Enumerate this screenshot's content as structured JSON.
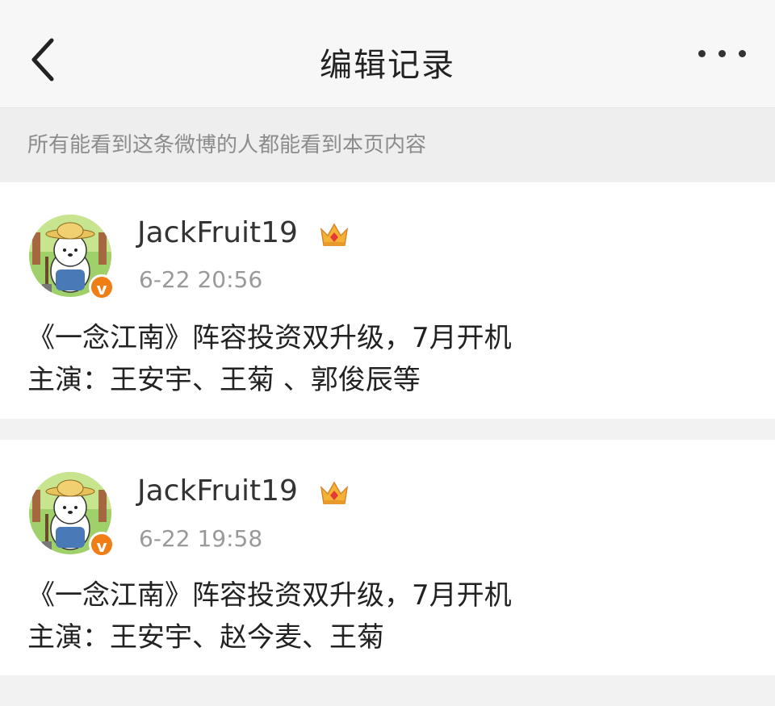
{
  "header": {
    "title": "编辑记录",
    "back_icon": "chevron-left-icon",
    "more_icon": "more-horizontal-icon"
  },
  "notice": {
    "text": "所有能看到这条微博的人都能看到本页内容"
  },
  "records": [
    {
      "username": "JackFruit19",
      "timestamp": "6-22 20:56",
      "lines": [
        "《一念江南》阵容投资双升级，7月开机",
        "主演：王安宇、王菊 、郭俊辰等"
      ]
    },
    {
      "username": "JackFruit19",
      "timestamp": "6-22 19:58",
      "lines": [
        "《一念江南》阵容投资双升级，7月开机",
        "主演：王安宇、赵今麦、王菊"
      ]
    }
  ],
  "colors": {
    "verified_badge": "#f07e14",
    "crown": "#f5b335",
    "background": "#f2f2f2"
  }
}
